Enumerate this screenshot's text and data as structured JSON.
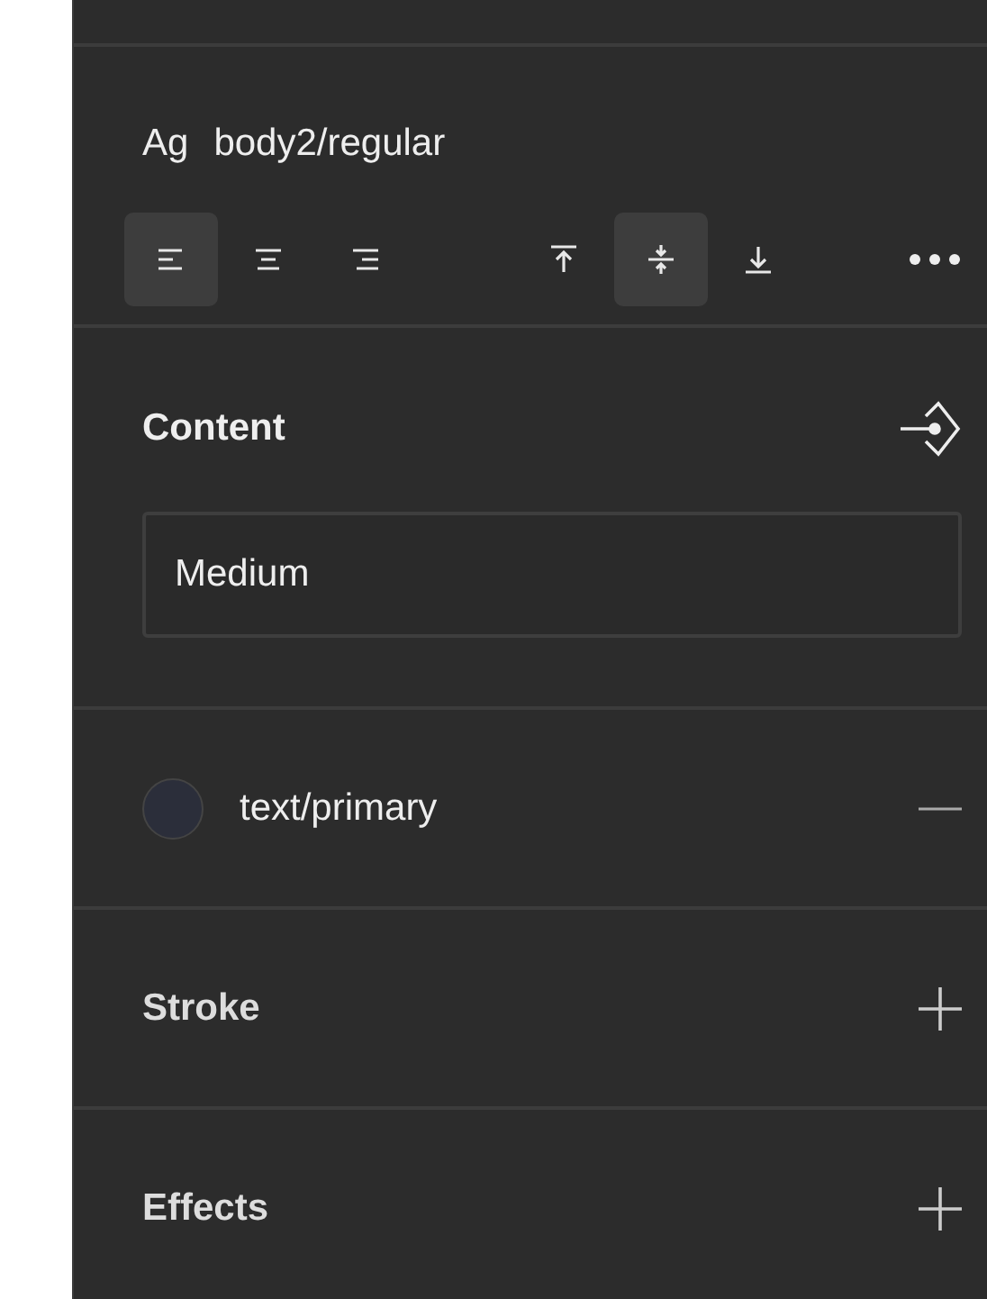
{
  "typography": {
    "preview": "Ag",
    "style": "body2/regular"
  },
  "text_align": [
    {
      "kind": "left",
      "selected": true
    },
    {
      "kind": "center",
      "selected": false
    },
    {
      "kind": "right",
      "selected": false
    }
  ],
  "vertical_align": [
    {
      "kind": "top",
      "selected": false
    },
    {
      "kind": "middle",
      "selected": true
    },
    {
      "kind": "bottom",
      "selected": false
    }
  ],
  "content": {
    "title": "Content",
    "value": "Medium"
  },
  "fill": {
    "color": "#2b2e3a",
    "label": "text/primary"
  },
  "sections": [
    {
      "title": "Stroke"
    },
    {
      "title": "Effects"
    }
  ]
}
